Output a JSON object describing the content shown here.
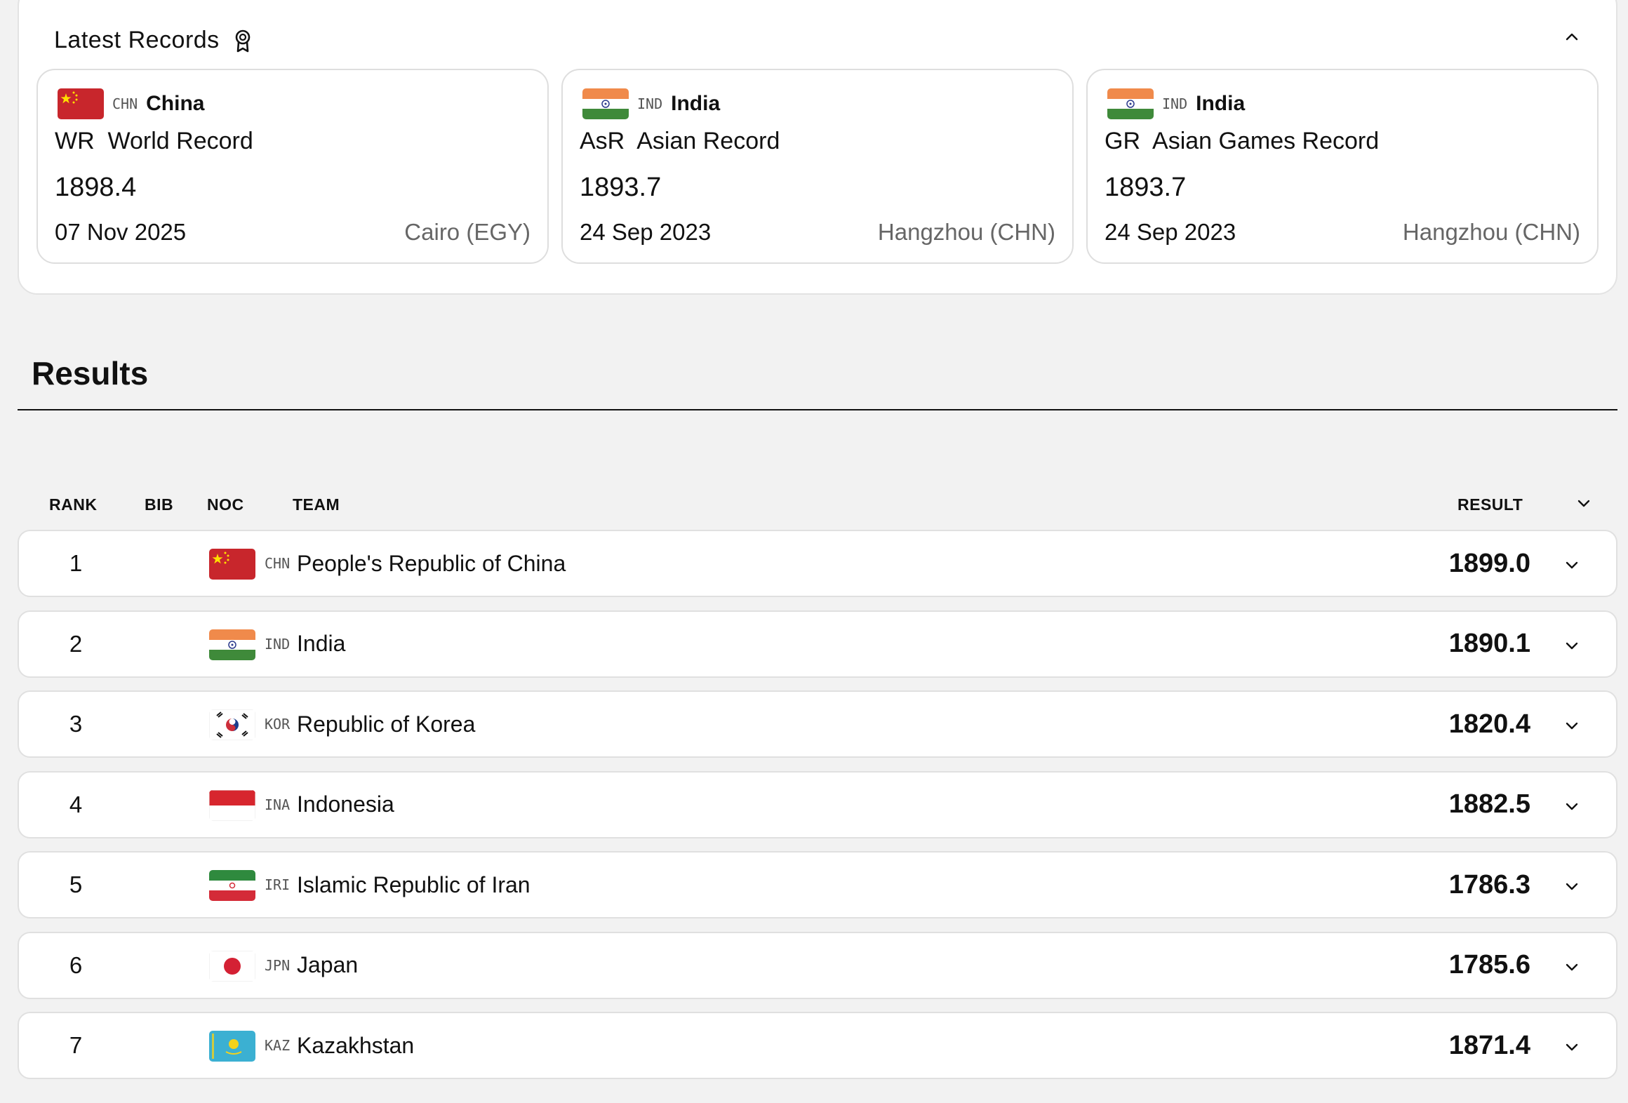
{
  "records": {
    "title": "Latest Records",
    "icon": "award-icon",
    "collapse_icon": "chevron-up-icon",
    "cards": [
      {
        "flag": "china-flag",
        "code": "CHN",
        "country": "China",
        "title": "WR  World Record",
        "value": "1898.4",
        "date": "07 Nov 2025",
        "place": "Cairo (EGY)"
      },
      {
        "flag": "india-flag",
        "code": "IND",
        "country": "India",
        "title": "AsR  Asian Record",
        "value": "1893.7",
        "date": "24 Sep 2023",
        "place": "Hangzhou (CHN)"
      },
      {
        "flag": "india-flag",
        "code": "IND",
        "country": "India",
        "title": "GR  Asian Games Record",
        "value": "1893.7",
        "date": "24 Sep 2023",
        "place": "Hangzhou (CHN)"
      }
    ]
  },
  "results": {
    "title": "Results",
    "columns": {
      "rank": "RANK",
      "bib": "BIB",
      "noc": "NOC",
      "team": "TEAM",
      "result": "RESULT"
    },
    "sort_icon": "chevron-down-icon",
    "rows": [
      {
        "rank": "1",
        "flag": "china-flag",
        "noc": "CHN",
        "team": "People's Republic of China",
        "result": "1899.0"
      },
      {
        "rank": "2",
        "flag": "india-flag",
        "noc": "IND",
        "team": "India",
        "result": "1890.1"
      },
      {
        "rank": "3",
        "flag": "korea-flag",
        "noc": "KOR",
        "team": "Republic of Korea",
        "result": "1820.4"
      },
      {
        "rank": "4",
        "flag": "indonesia-flag",
        "noc": "INA",
        "team": "Indonesia",
        "result": "1882.5"
      },
      {
        "rank": "5",
        "flag": "iran-flag",
        "noc": "IRI",
        "team": "Islamic Republic of Iran",
        "result": "1786.3"
      },
      {
        "rank": "6",
        "flag": "japan-flag",
        "noc": "JPN",
        "team": "Japan",
        "result": "1785.6"
      },
      {
        "rank": "7",
        "flag": "kazakhstan-flag",
        "noc": "KAZ",
        "team": "Kazakhstan",
        "result": "1871.4"
      }
    ]
  },
  "colors": {
    "background": "#f2f2f2",
    "card": "#ffffff",
    "border": "#e0e0e0",
    "text": "#111111",
    "muted": "#666666"
  }
}
